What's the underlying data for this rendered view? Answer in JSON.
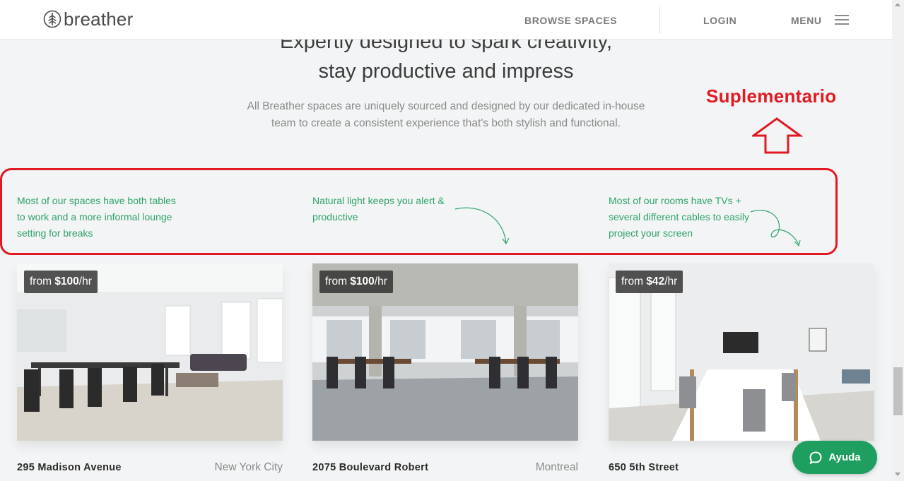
{
  "header": {
    "logo_text": "breather",
    "nav": {
      "browse": "BROWSE SPACES",
      "login": "LOGIN",
      "menu": "MENU"
    }
  },
  "intro": {
    "heading_line1": "Expertly designed to spark creativity,",
    "heading_line2": "stay productive and impress",
    "subtitle": "All Breather spaces are uniquely sourced and designed by our dedicated in-house team to create a consistent experience that's both stylish and functional."
  },
  "annotation": {
    "label": "Suplementario",
    "color": "#e01a22"
  },
  "features": [
    {
      "text": "Most of our spaces have both tables to work and a more informal lounge setting for breaks"
    },
    {
      "text": "Natural light keeps you alert & productive"
    },
    {
      "text": "Most of our rooms have TVs + several different cables to easily project your screen"
    }
  ],
  "cards": [
    {
      "price_prefix": "from ",
      "price": "$100",
      "price_suffix": "/hr",
      "name": "295 Madison Avenue",
      "city": "New York City"
    },
    {
      "price_prefix": "from ",
      "price": "$100",
      "price_suffix": "/hr",
      "name": "2075 Boulevard Robert",
      "city": "Montreal"
    },
    {
      "price_prefix": "from ",
      "price": "$42",
      "price_suffix": "/hr",
      "name": "650 5th Street",
      "city": ""
    }
  ],
  "help": {
    "label": "Ayuda"
  },
  "colors": {
    "accent_green": "#2fa36b",
    "help_green": "#1e9e5f",
    "annotation_red": "#e01a22"
  }
}
